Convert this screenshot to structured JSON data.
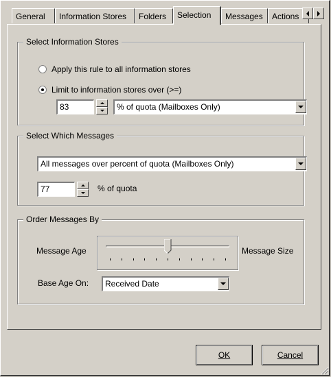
{
  "tabs": {
    "items": [
      "General",
      "Information Stores",
      "Folders",
      "Selection",
      "Messages",
      "Actions"
    ],
    "active": "Selection"
  },
  "stores_group": {
    "legend": "Select Information Stores",
    "radio_all": "Apply this rule to all information stores",
    "radio_limit": "Limit to information stores over (>=)",
    "selected": "limit",
    "threshold_value": "83",
    "quota_type": "% of quota (Mailboxes Only)"
  },
  "messages_group": {
    "legend": "Select Which Messages",
    "criteria": "All messages over percent of quota (Mailboxes Only)",
    "percent_value": "77",
    "percent_label": "% of quota"
  },
  "order_group": {
    "legend": "Order Messages By",
    "left_label": "Message Age",
    "right_label": "Message Size",
    "slider_position": 0.5,
    "slider_ticks": 11,
    "base_age_label": "Base Age On:",
    "base_age_value": "Received Date"
  },
  "buttons": {
    "ok": "OK",
    "cancel": "Cancel"
  },
  "colors": {
    "face": "#d4d0c8",
    "shadow": "#808080",
    "highlight": "#ffffff",
    "dark_shadow": "#404040"
  }
}
